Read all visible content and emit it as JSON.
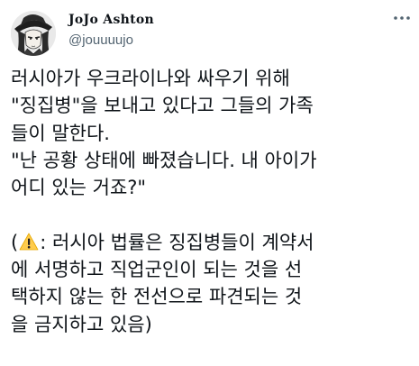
{
  "author": {
    "display_name": "JoJo Ashton",
    "handle": "@jouuuujo",
    "avatar_icon": "anime-character-avatar"
  },
  "menu": {
    "more_icon": "more-dots-icon"
  },
  "tweet": {
    "lines": [
      "러시아가 우크라이나와 싸우기 위해",
      "\"징집병\"을 보내고 있다고 그들의 가족",
      "들이 말한다.",
      "\"난 공황 상태에 빠졌습니다. 내 아이가",
      "어디 있는 거죠?\"",
      "",
      "",
      "에 서명하고 직업군인이 되는 것을 선",
      "택하지 않는 한 전선으로 파견되는 것",
      "을 금지하고 있음)"
    ],
    "warning_line": {
      "prefix": "(",
      "icon": "warning-icon",
      "suffix": ": 러시아 법률은 징집병들이 계약서"
    }
  },
  "colors": {
    "text": "#0f1419",
    "secondary": "#536471",
    "warning_fill": "#ffcc4d"
  }
}
